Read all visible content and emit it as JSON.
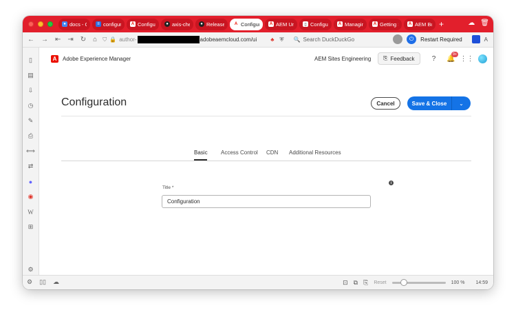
{
  "browser": {
    "tabs": [
      {
        "label": "docs - G",
        "icon": "google-docs-icon",
        "icon_color": "#4285f4"
      },
      {
        "label": "configura",
        "icon": "document-icon",
        "icon_color": "#2f6fe0"
      },
      {
        "label": "Configur",
        "icon": "adobe-icon",
        "icon_color": "#eb1000"
      },
      {
        "label": "axis-chec",
        "icon": "github-icon",
        "icon_color": "#222222"
      },
      {
        "label": "Releases",
        "icon": "github-icon",
        "icon_color": "#222222"
      },
      {
        "label": "Configur",
        "icon": "adobe-icon",
        "icon_color": "#eb1000",
        "active": true
      },
      {
        "label": "AEM Uni",
        "icon": "adobe-icon",
        "icon_color": "#eb1000"
      },
      {
        "label": "Configur",
        "icon": "document-icon",
        "icon_color": "#ffffff"
      },
      {
        "label": "Managing",
        "icon": "adobe-icon",
        "icon_color": "#eb1000"
      },
      {
        "label": "Getting S",
        "icon": "adobe-icon",
        "icon_color": "#eb1000"
      },
      {
        "label": "AEM Boil",
        "icon": "adobe-icon",
        "icon_color": "#eb1000"
      }
    ],
    "new_tab": "+",
    "url_prefix": "author-",
    "url_domain": "adobeaemcloud.com/ui",
    "search_placeholder": "Search DuckDuckGo",
    "restart_label": "Restart Required",
    "zoom_reset": "Reset",
    "zoom_level": "100 %",
    "clock": "14:59",
    "accent_color": "#e21f2c"
  },
  "aem": {
    "product_name": "Adobe Experience Manager",
    "org_name": "AEM Sites Engineering",
    "feedback_label": "Feedback",
    "notification_count": "9+",
    "page_title": "Configuration",
    "cancel_label": "Cancel",
    "save_label": "Save & Close",
    "tabs": [
      "Basic",
      "Access Control",
      "CDN",
      "Additional Resources"
    ],
    "selected_tab": "Basic",
    "field_label": "Title *",
    "field_value": "Configuration",
    "primary_color": "#1473e6"
  }
}
